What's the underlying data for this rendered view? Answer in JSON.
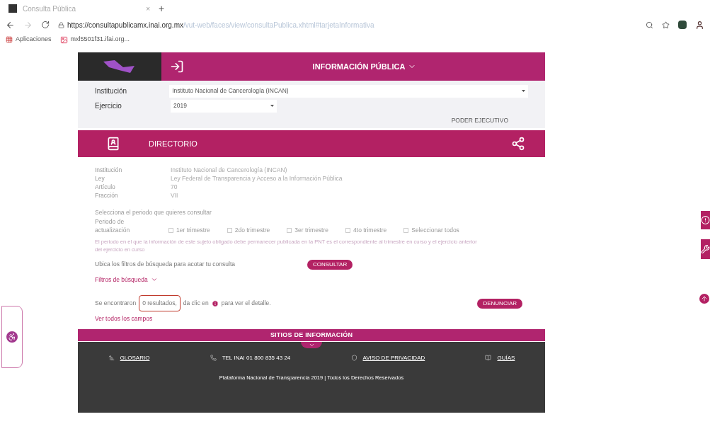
{
  "browser": {
    "tab_title": "Consulta Pública",
    "tab_close": "×",
    "new_tab": "+",
    "url_host": "https://consultapublicamx.inai.org.mx",
    "url_path": "/vut-web/faces/view/consultaPublica.xhtml#tarjetaInformativa",
    "bookmarks": [
      "Aplicaciones",
      "mxl5501f31.ifai.org..."
    ]
  },
  "header": {
    "title": "INFORMACIÓN PÚBLICA"
  },
  "form": [
    {
      "label": "Institución",
      "value": "Instituto Nacional de Cancerología (INCAN)"
    },
    {
      "label": "Ejercicio",
      "value": "2019"
    }
  ],
  "branch": "PODER EJECUTIVO",
  "section": {
    "title": "DIRECTORIO"
  },
  "details": [
    {
      "label": "Institución",
      "value": "Instituto Nacional de Cancerología (INCAN)"
    },
    {
      "label": "Ley",
      "value": "Ley Federal de Transparencia y Acceso a la Información Pública"
    },
    {
      "label": "Artículo",
      "value": "70"
    },
    {
      "label": "Fracción",
      "value": "VII"
    }
  ],
  "period": {
    "prompt": "Selecciona el periodo que quieres consultar",
    "label": "Periodo de actualización",
    "options": [
      {
        "label": "1er trimestre",
        "checked": false
      },
      {
        "label": "2do trimestre",
        "checked": false
      },
      {
        "label": "3er trimestre",
        "checked": false
      },
      {
        "label": "4to trimestre",
        "checked": false
      },
      {
        "label": "Seleccionar todos",
        "checked": false
      }
    ]
  },
  "note": "El periodo en el que la información de este sujeto obligado debe permanecer publicada en la PNT es el correspondiente al trimestre en curso y el ejercicio anterior",
  "note_link": "del ejercicio en curso",
  "filter_hint": "Ubica los filtros de búsqueda para acotar tu consulta",
  "consult_button": "CONSULTAR",
  "filters_toggle": "Filtros de búsqueda",
  "results": {
    "before": "Se encontraron",
    "count": "0 resultados,",
    "after": "da clic en",
    "tail": "para ver el detalle."
  },
  "report_button": "DENUNCIAR",
  "view_all": "Ver todos los campos",
  "footer": {
    "title": "SITIOS DE INFORMACIÓN",
    "links": [
      "GLOSARIO",
      "TEL INAI 01 800 835 43 24",
      "AVISO DE PRIVACIDAD",
      "GUÍAS"
    ],
    "copyright": "Plataforma Nacional de Transparencia 2019 | Todos los Derechos Reservados"
  }
}
